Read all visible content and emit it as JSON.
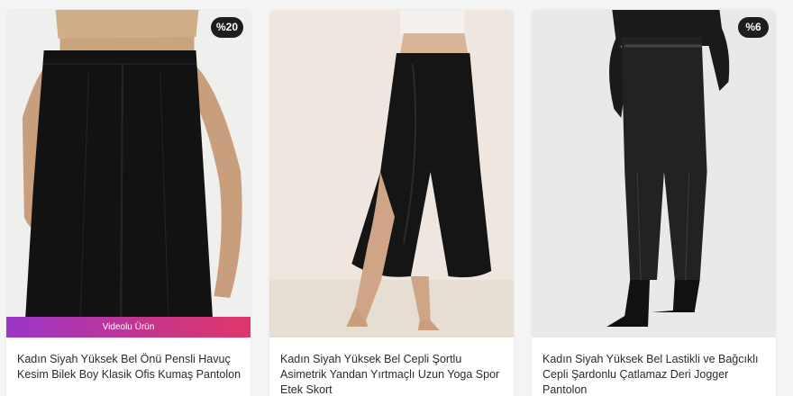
{
  "products": [
    {
      "title": "Kadın Siyah Yüksek Bel Önü Pensli Havuç Kesim Bilek Boy Klasik Ofis Kumaş Pantolon",
      "discount_badge": "%20",
      "video_label": "Videolu Ürün",
      "image_icon": "black-trousers-image"
    },
    {
      "title": "Kadın Siyah Yüksek Bel Cepli Şortlu Asimetrik Yandan Yırtmaçlı Uzun Yoga Spor Etek Skort",
      "image_icon": "black-skort-image"
    },
    {
      "title": "Kadın Siyah Yüksek Bel Lastikli ve Bağcıklı Cepli Şardonlu Çatlamaz Deri Jogger Pantolon",
      "discount_badge": "%6",
      "image_icon": "leather-jogger-image"
    }
  ],
  "colors": {
    "badge_bg": "#1d1d1d",
    "video_gradient_start": "#9a36c9",
    "video_gradient_end": "#e0376a",
    "title_text": "#2b2b2b"
  }
}
